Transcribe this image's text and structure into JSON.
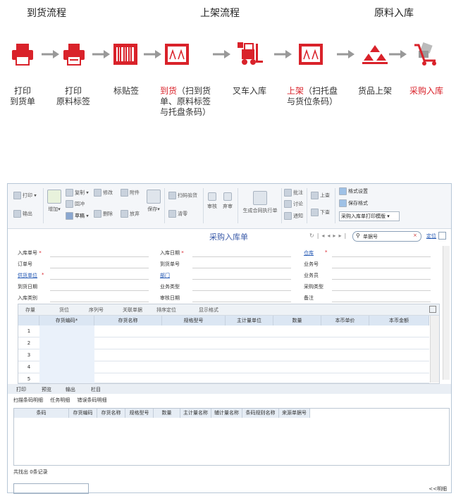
{
  "flow": {
    "headers": [
      "到货流程",
      "上架流程",
      "原料入库"
    ],
    "steps": [
      {
        "label": "打印\n到货单",
        "highlight": "",
        "icon": "printer-icon"
      },
      {
        "label": "打印\n原料标签",
        "highlight": "",
        "icon": "printer-label-icon"
      },
      {
        "label": "标贴签",
        "highlight": "",
        "icon": "barcode-icon"
      },
      {
        "label": "（扫到货\n单、原料标签\n与托盘条码）",
        "highlight": "到货",
        "icon": "scanner-icon"
      },
      {
        "label": "叉车入库",
        "highlight": "",
        "icon": "forklift-icon"
      },
      {
        "label": "（扫托盘\n与货位条码）",
        "highlight": "上架",
        "icon": "scanner-icon"
      },
      {
        "label": "货品上架",
        "highlight": "",
        "icon": "stack-icon"
      },
      {
        "label": "采购入库",
        "highlight": "",
        "icon": "cart-icon",
        "red": true
      }
    ]
  },
  "toolbar": {
    "print": "打印",
    "export": "输出",
    "add": "增加",
    "copy": "复制",
    "redflush": "回冲",
    "draft": "草稿",
    "modify": "修改",
    "attach": "附件",
    "delete": "删除",
    "abandon": "放弃",
    "save": "保存",
    "scan_verify": "扫码验货",
    "clear": "清零",
    "audit": "审核",
    "discard": "弃审",
    "gen_contract": "生成合同执行单",
    "approve": "批注",
    "discuss": "讨论",
    "notify": "通知",
    "prev": "上查",
    "next": "下查",
    "format_set": "格式设置",
    "save_format": "保存格式",
    "template": "采购入库单打印模版"
  },
  "doc": {
    "title": "采购入库单",
    "search_placeholder": "单据号",
    "locate": "定位"
  },
  "form": {
    "col1": [
      "入库单号",
      "订单号",
      "供货单位",
      "到货日期",
      "入库类别"
    ],
    "col2": [
      "入库日期",
      "到货单号",
      "部门",
      "业务类型",
      "审核日期"
    ],
    "col3": [
      "仓库",
      "业务号",
      "业务员",
      "采购类型",
      "备注"
    ]
  },
  "grid": {
    "tools": [
      "存量",
      "货位",
      "序列号",
      "关联单据",
      "排序定位",
      "显示格式"
    ],
    "headers": [
      "",
      "存货编码*",
      "存货名称",
      "规格型号",
      "主计量单位",
      "数量",
      "本币单价",
      "本币金额"
    ],
    "rows": [
      "1",
      "2",
      "3",
      "4",
      "5"
    ]
  },
  "ptool": [
    "打印",
    "预览",
    "输出",
    "栏目"
  ],
  "tabs": [
    "扫描条码明细",
    "任务明细",
    "错误条码明细"
  ],
  "sub_headers": [
    "条码",
    "存货编码",
    "存货名称",
    "规格型号",
    "数量",
    "主计量名称",
    "辅计量名称",
    "条码规则名称",
    "来源单据号"
  ],
  "footer": "共找出 0条记录",
  "more": "<<明细"
}
